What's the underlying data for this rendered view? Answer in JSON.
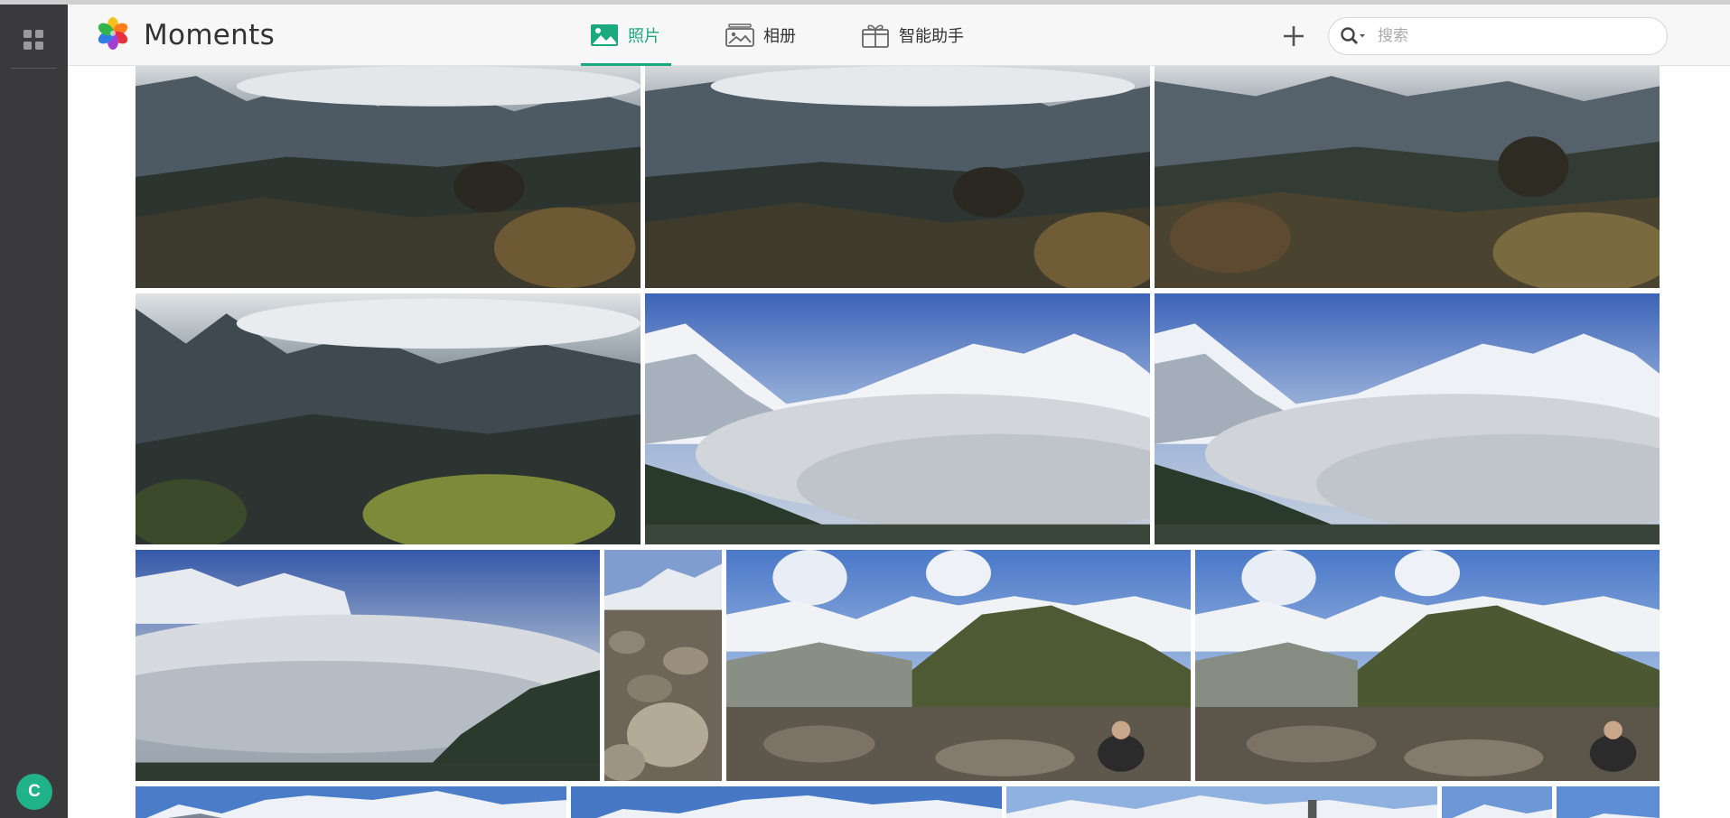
{
  "app": {
    "title": "Moments",
    "logo_icon": "flower-logo-icon"
  },
  "sidebar": {
    "apps_icon": "grid-apps-icon",
    "user_initial": "C",
    "user_color": "#20b38a"
  },
  "tabs": [
    {
      "label": "照片",
      "icon": "photo-icon",
      "active": true
    },
    {
      "label": "相册",
      "icon": "album-icon",
      "active": false
    },
    {
      "label": "智能助手",
      "icon": "gift-assistant-icon",
      "active": false
    }
  ],
  "toolbar": {
    "add_icon": "plus-icon",
    "search_icon": "search-dropdown-icon",
    "search_placeholder": "搜索",
    "search_value": ""
  },
  "colors": {
    "accent": "#1aa97d",
    "sidebar_bg": "#3a3a3c",
    "header_bg": "#f7f7f7"
  },
  "photos": [
    {
      "subject": "misty-forest-valley"
    },
    {
      "subject": "misty-forest-valley"
    },
    {
      "subject": "misty-forest-valley"
    },
    {
      "subject": "misty-forest-valley"
    },
    {
      "subject": "snow-peaks-sea-of-clouds"
    },
    {
      "subject": "snow-peaks-sea-of-clouds"
    },
    {
      "subject": "snow-peaks-sea-of-clouds"
    },
    {
      "subject": "rocky-boulder-field"
    },
    {
      "subject": "snow-peaks-rocky-slope"
    },
    {
      "subject": "snow-peaks-rocky-slope"
    },
    {
      "subject": "snowy-mountain-ridge"
    },
    {
      "subject": "snowy-mountain-ridge"
    },
    {
      "subject": "snowy-mountain-ridge"
    },
    {
      "subject": "snowy-mountain-ridge"
    },
    {
      "subject": "snowy-mountain-ridge"
    }
  ]
}
